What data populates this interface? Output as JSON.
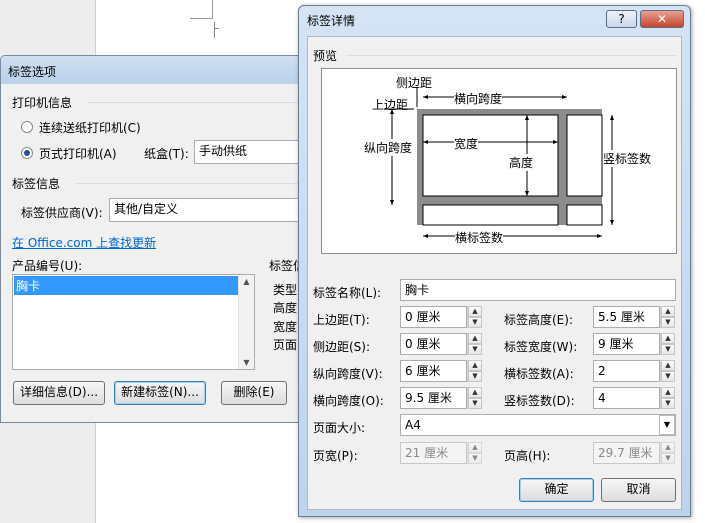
{
  "label_options": {
    "title": "标签选项",
    "printer_info_title": "打印机信息",
    "continuous_radio": "连续送纸打印机(C)",
    "page_radio": "页式打印机(A)",
    "tray_label": "纸盒(T):",
    "tray_value": "手动供纸",
    "label_info_title": "标签信息",
    "vendor_label": "标签供应商(V):",
    "vendor_value": "其他/自定义",
    "office_link": "在 Office.com 上查找更新",
    "product_label": "产品编号(U):",
    "product_items": [
      "胸卡"
    ],
    "label_info_partial": "标签信",
    "info_rows": [
      "类型:",
      "高度:",
      "宽度:",
      "页面"
    ],
    "details_button": "详细信息(D)...",
    "new_label_button": "新建标签(N)...",
    "delete_button": "删除(E)"
  },
  "label_details": {
    "title": "标签详情",
    "help_button": "?",
    "close_button": "✕",
    "preview_title": "预览",
    "preview": {
      "side_margin": "侧边距",
      "top_margin": "上边距",
      "horizontal_pitch": "横向跨度",
      "vertical_pitch": "纵向跨度",
      "width": "宽度",
      "height": "高度",
      "number_down": "竖标签数",
      "number_across": "横标签数"
    },
    "label_name_label": "标签名称(L):",
    "label_name_value": "胸卡",
    "fields": [
      {
        "label": "上边距(T):",
        "value": "0 厘米",
        "disabled": false
      },
      {
        "label": "侧边距(S):",
        "value": "0 厘米",
        "disabled": false
      },
      {
        "label": "纵向跨度(V):",
        "value": "6 厘米",
        "disabled": false
      },
      {
        "label": "横向跨度(O):",
        "value": "9.5 厘米",
        "disabled": false
      }
    ],
    "fields_right": [
      {
        "label": "标签高度(E):",
        "value": "5.5 厘米"
      },
      {
        "label": "标签宽度(W):",
        "value": "9 厘米"
      },
      {
        "label": "横标签数(A):",
        "value": "2"
      },
      {
        "label": "竖标签数(D):",
        "value": "4"
      }
    ],
    "page_size_label": "页面大小:",
    "page_size_value": "A4",
    "page_width_label": "页宽(P):",
    "page_width_value": "21 厘米",
    "page_height_label": "页高(H):",
    "page_height_value": "29.7 厘米",
    "ok_button": "确定",
    "cancel_button": "取消"
  }
}
